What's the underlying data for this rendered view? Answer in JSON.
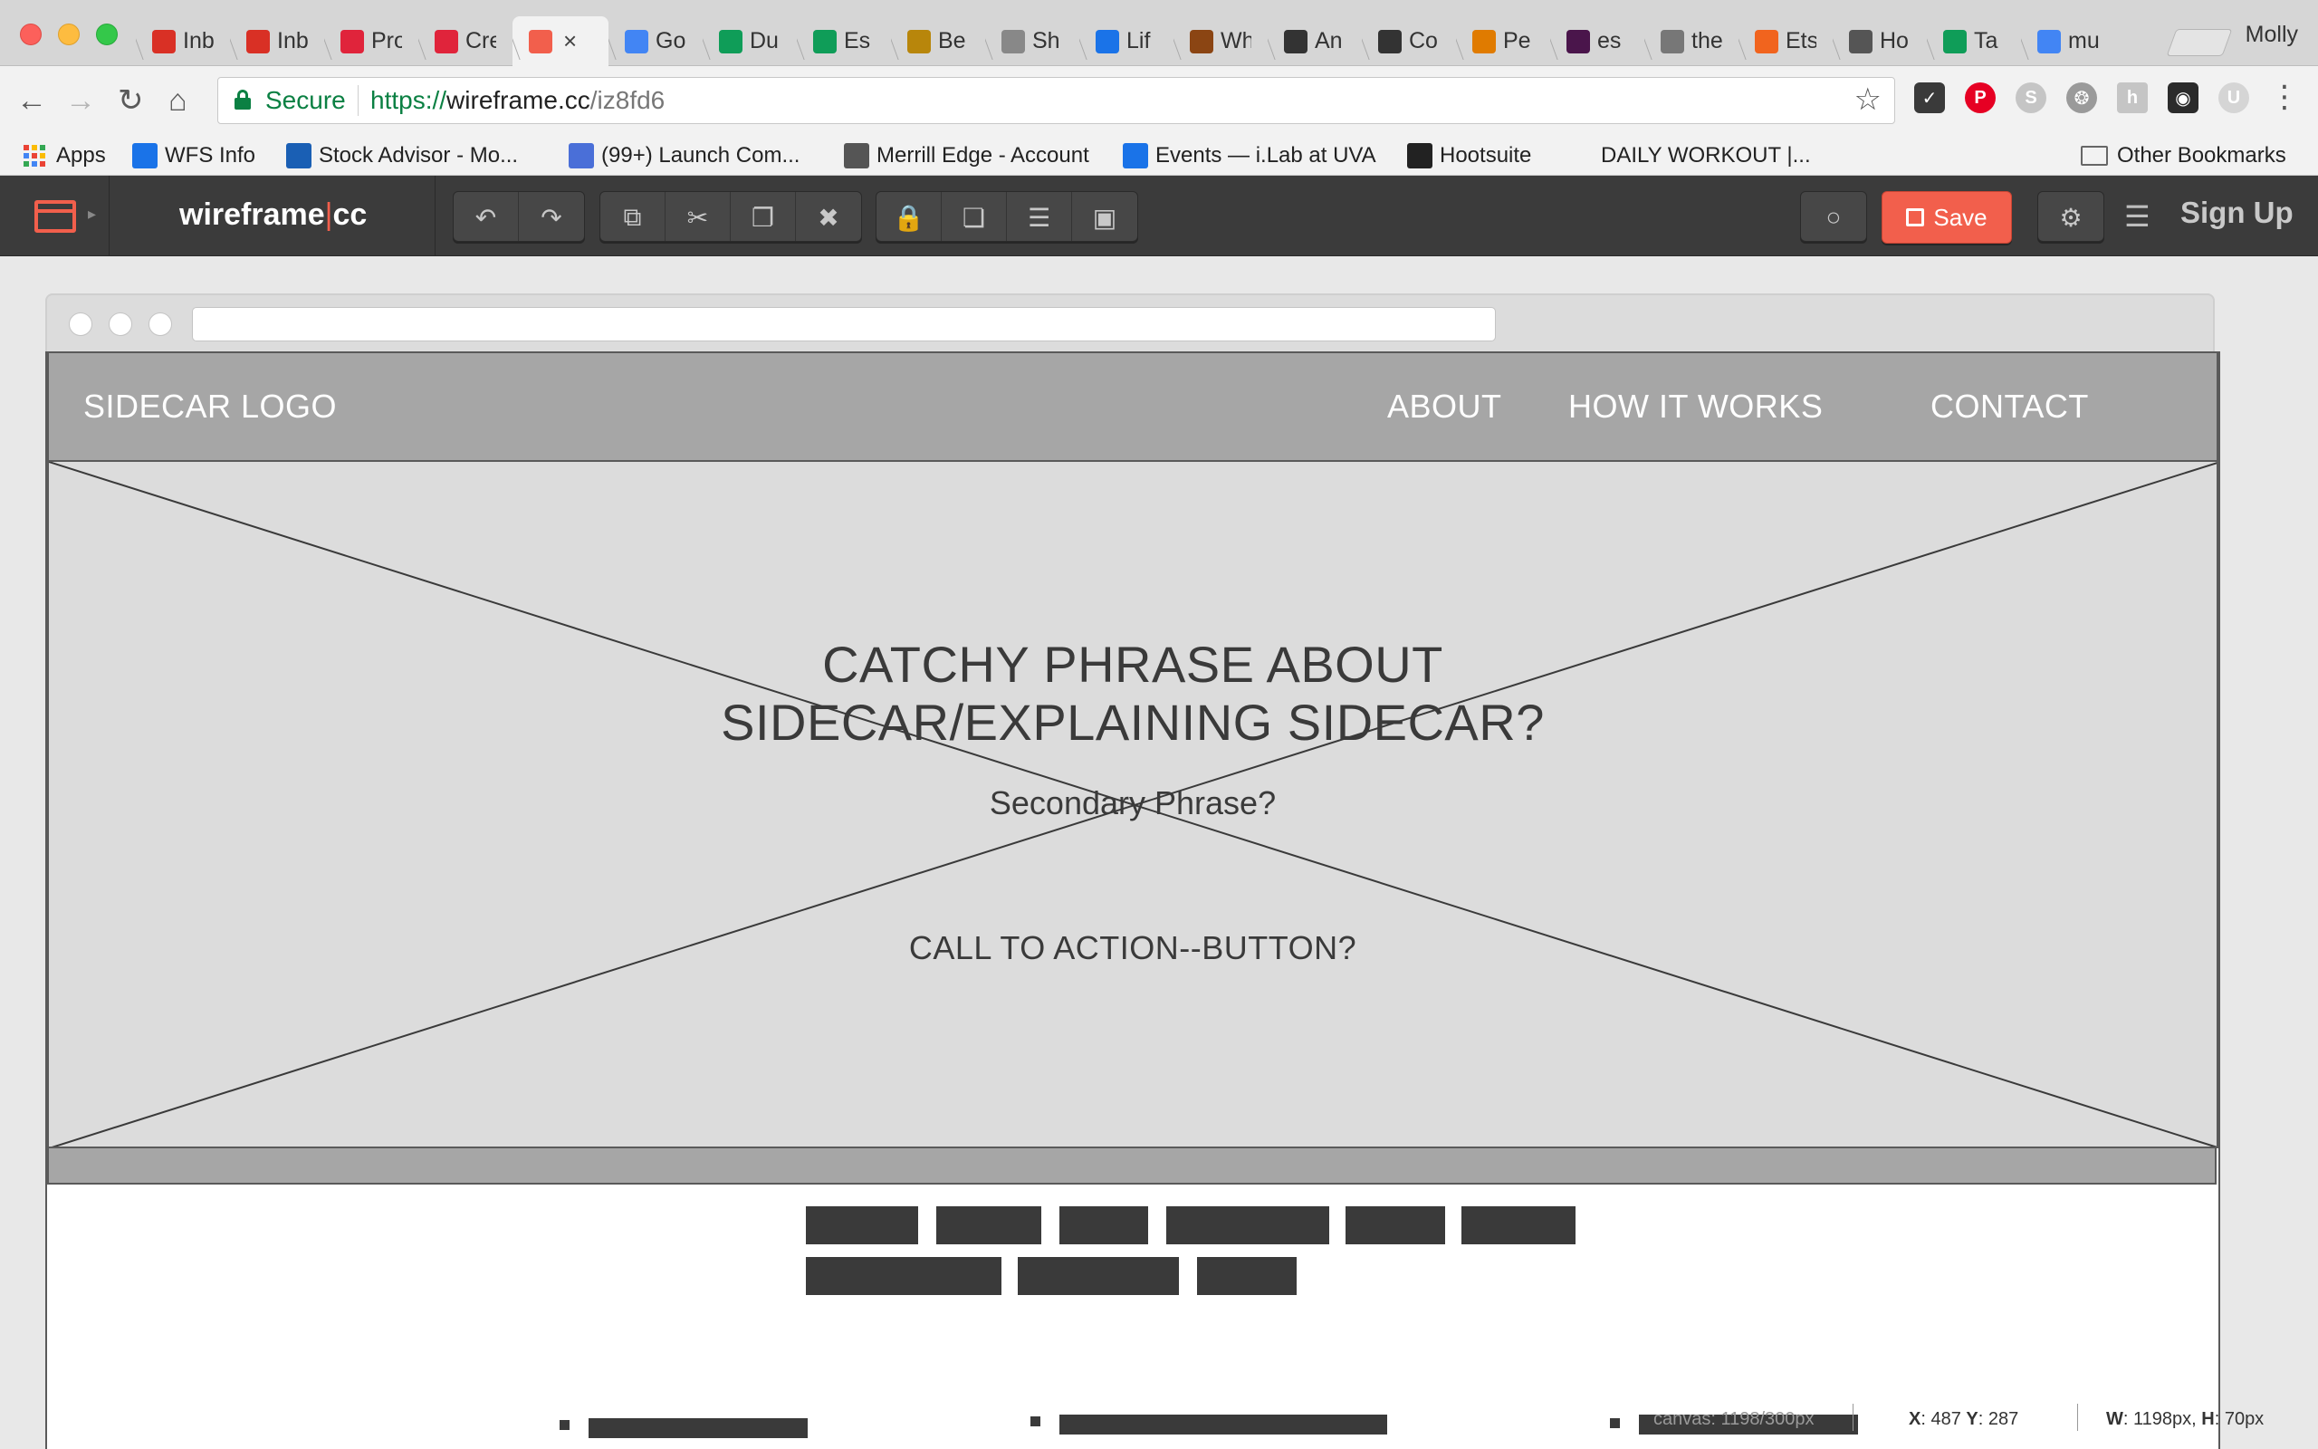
{
  "browser": {
    "profile_name": "Molly",
    "tabs": [
      {
        "title": "Inb",
        "favicon": "gmail-icon",
        "color": "#d93025"
      },
      {
        "title": "Inb",
        "favicon": "gmail-icon",
        "color": "#d93025"
      },
      {
        "title": "Pro",
        "favicon": "ga-icon",
        "color": "#e0243b"
      },
      {
        "title": "Cre",
        "favicon": "ga-icon",
        "color": "#e0243b"
      },
      {
        "title": "",
        "favicon": "wireframe-icon",
        "color": "#f25f4c",
        "active": true
      },
      {
        "title": "Go",
        "favicon": "google-calendar-icon",
        "color": "#4285f4"
      },
      {
        "title": "Du",
        "favicon": "google-sheets-icon",
        "color": "#0f9d58"
      },
      {
        "title": "Es",
        "favicon": "google-sheets-icon",
        "color": "#0f9d58"
      },
      {
        "title": "Be",
        "favicon": "horse-icon",
        "color": "#b8860b"
      },
      {
        "title": "Sh",
        "favicon": "spiral-icon",
        "color": "#888888"
      },
      {
        "title": "Lif",
        "favicon": "crown-icon",
        "color": "#1a73e8"
      },
      {
        "title": "Wh",
        "favicon": "books-icon",
        "color": "#8b4513"
      },
      {
        "title": "An",
        "favicon": "cube-icon",
        "color": "#333333"
      },
      {
        "title": "Co",
        "favicon": "cm-icon",
        "color": "#333333"
      },
      {
        "title": "Pe",
        "favicon": "figure-icon",
        "color": "#e07b00"
      },
      {
        "title": "es",
        "favicon": "hash-icon",
        "color": "#4a154b"
      },
      {
        "title": "the",
        "favicon": "document-icon",
        "color": "#777777"
      },
      {
        "title": "Ets",
        "favicon": "etsy-icon",
        "color": "#f1641e"
      },
      {
        "title": "Ho",
        "favicon": "apple-icon",
        "color": "#555555"
      },
      {
        "title": "Ta",
        "favicon": "tab-icon",
        "color": "#0f9d58"
      },
      {
        "title": "mu",
        "favicon": "google-icon",
        "color": "#4285f4"
      }
    ],
    "secure_label": "Secure",
    "url": {
      "scheme": "https://",
      "host": "wireframe.cc",
      "path": "/iz8fd6"
    },
    "bookmarks": [
      {
        "label": "Apps",
        "icon": "apps-grid-icon"
      },
      {
        "label": "WFS Info",
        "icon": "layout-icon"
      },
      {
        "label": "Stock Advisor - Mo...",
        "icon": "motley-fool-icon"
      },
      {
        "label": "(99+) Launch Com...",
        "icon": "people-icon"
      },
      {
        "label": "Merrill Edge - Account",
        "icon": "bull-icon"
      },
      {
        "label": "Events — i.Lab at UVA",
        "icon": "ilab-icon"
      },
      {
        "label": "Hootsuite",
        "icon": "owl-icon"
      },
      {
        "label": "DAILY WORKOUT |...",
        "icon": ""
      },
      {
        "label": "Other Bookmarks",
        "icon": "folder-icon"
      }
    ]
  },
  "app": {
    "brand_left": "wireframe",
    "brand_sep": "|",
    "brand_right": "cc",
    "save_label": "Save",
    "signup_label": "Sign Up",
    "accent_color": "#f25f4c"
  },
  "wireframe": {
    "logo": "SIDECAR LOGO",
    "nav": [
      "ABOUT",
      "HOW IT WORKS",
      "CONTACT"
    ],
    "hero_title_line1": "CATCHY PHRASE ABOUT",
    "hero_title_line2": "SIDECAR/EXPLAINING SIDECAR?",
    "hero_subtitle": "Secondary Phrase?",
    "hero_cta": "CALL TO ACTION--BUTTON?"
  },
  "status": {
    "canvas_label": "canvas: 1198/300px",
    "x_label": "X",
    "x_value": ": 487 ",
    "y_label": "Y",
    "y_value": ": 287",
    "w_label": "W",
    "w_value": ": 1198px, ",
    "h_label": "H",
    "h_value": ": 70px"
  }
}
